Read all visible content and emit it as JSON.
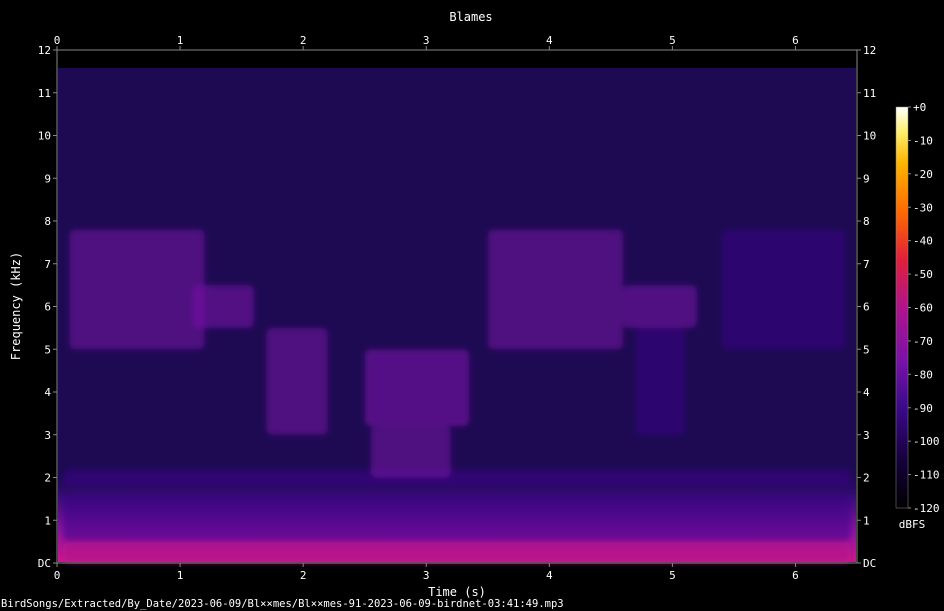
{
  "chart_data": {
    "type": "heatmap",
    "title": "Blames",
    "xlabel": "Time (s)",
    "ylabel": "Frequency (kHz)",
    "x_ticks": [
      "0",
      "1",
      "2",
      "3",
      "4",
      "5",
      "6"
    ],
    "xlim": [
      0,
      6.5
    ],
    "y_ticks": [
      "DC",
      "1",
      "2",
      "3",
      "4",
      "5",
      "6",
      "7",
      "8",
      "9",
      "10",
      "11",
      "12"
    ],
    "ylim": [
      0,
      12
    ],
    "colorbar": {
      "label": "dBFS",
      "ticks": [
        "+0",
        "-10",
        "-20",
        "-30",
        "-40",
        "-50",
        "-60",
        "-70",
        "-80",
        "-90",
        "-100",
        "-110",
        "-120"
      ],
      "range": [
        -120,
        0
      ],
      "colors": [
        "#000000",
        "#15003a",
        "#3a0a8a",
        "#7a12a8",
        "#b0148c",
        "#e0203a",
        "#ff6a00",
        "#ffb400",
        "#fff070",
        "#ffffff"
      ]
    },
    "background_level_db": -100,
    "events": [
      {
        "t_start": 0.05,
        "t_end": 6.45,
        "f_low": 0.0,
        "f_high": 0.5,
        "level_db": -72
      },
      {
        "t_start": 0.05,
        "t_end": 6.45,
        "f_low": 0.5,
        "f_high": 1.6,
        "level_db": -90
      },
      {
        "t_start": 0.05,
        "t_end": 6.45,
        "f_low": 1.8,
        "f_high": 2.2,
        "level_db": -88
      },
      {
        "t_start": 2.5,
        "t_end": 3.35,
        "f_low": 3.2,
        "f_high": 5.0,
        "level_db": -78
      },
      {
        "t_start": 2.55,
        "t_end": 3.2,
        "f_low": 2.0,
        "f_high": 3.2,
        "level_db": -86
      },
      {
        "t_start": 0.1,
        "t_end": 1.2,
        "f_low": 5.0,
        "f_high": 7.8,
        "level_db": -86
      },
      {
        "t_start": 1.1,
        "t_end": 1.6,
        "f_low": 5.5,
        "f_high": 6.5,
        "level_db": -82
      },
      {
        "t_start": 1.7,
        "t_end": 2.2,
        "f_low": 3.0,
        "f_high": 5.5,
        "level_db": -86
      },
      {
        "t_start": 3.5,
        "t_end": 4.6,
        "f_low": 5.0,
        "f_high": 7.8,
        "level_db": -86
      },
      {
        "t_start": 4.6,
        "t_end": 5.2,
        "f_low": 5.5,
        "f_high": 6.5,
        "level_db": -84
      },
      {
        "t_start": 4.7,
        "t_end": 5.1,
        "f_low": 3.0,
        "f_high": 5.5,
        "level_db": -88
      },
      {
        "t_start": 5.4,
        "t_end": 6.4,
        "f_low": 5.0,
        "f_high": 7.8,
        "level_db": -88
      }
    ],
    "grid": false,
    "legend": "none"
  },
  "footer": {
    "file_path": "BirdSongs/Extracted/By_Date/2023-06-09/Bl××mes/Bl××mes-91-2023-06-09-birdnet-03:41:49.mp3"
  }
}
